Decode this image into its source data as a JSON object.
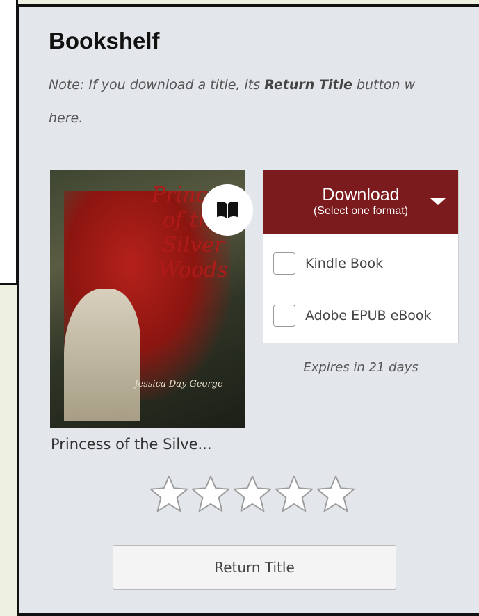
{
  "bookshelf": {
    "title": "Bookshelf",
    "note_prefix": "Note: If you download a title, its ",
    "note_bold": "Return Title",
    "note_suffix": " button w",
    "note_line2": "here."
  },
  "book": {
    "title": "Princess of the Silve...",
    "cover_title": "Princess of the Silver Woods",
    "cover_author": "Jessica Day George",
    "expires": "Expires in 21 days",
    "rating_stars": 5,
    "rating_value": 0
  },
  "download": {
    "label": "Download",
    "sublabel": "(Select one format)",
    "options": [
      {
        "label": "Kindle Book",
        "checked": false
      },
      {
        "label": "Adobe EPUB eBook",
        "checked": false
      }
    ]
  },
  "return_button": {
    "label": "Return Title"
  },
  "icons": {
    "read": "open-book-icon",
    "dropdown": "caret-down-icon",
    "rating": "star-outline-icon"
  },
  "colors": {
    "download_bg": "#7c1b1d",
    "panel_bg": "#e3e6ea",
    "star": "#ffffff"
  }
}
